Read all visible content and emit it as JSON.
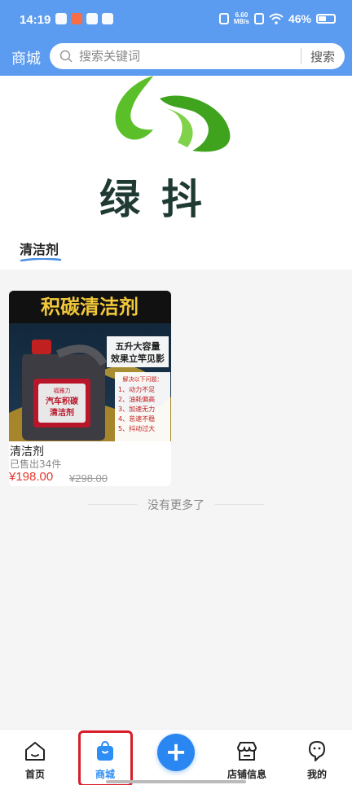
{
  "status_bar": {
    "time": "14:19",
    "net_speed": "6.60",
    "net_unit": "MB/s",
    "battery": "46%"
  },
  "header": {
    "title": "商城",
    "search_placeholder": "搜索关键词",
    "search_button": "搜索"
  },
  "store": {
    "logo_text": "绿抖",
    "category_tab": "清洁剂"
  },
  "products": [
    {
      "name": "清洁剂",
      "sold": "已售出34件",
      "price": "¥198.00",
      "original_price": "¥298.00",
      "image_text": {
        "headline": "积碳清洁剂",
        "promo_line1": "五升大容量",
        "promo_line2": "效果立竿见影",
        "bottle_brand": "福雅力",
        "bottle_label1": "汽车积碳",
        "bottle_label2": "清洁剂",
        "problems_title": "解决以下问题：",
        "problems": [
          "1、动力不足",
          "2、油耗偏高",
          "3、加速无力",
          "4、怠速不稳",
          "5、抖动过大"
        ]
      }
    }
  ],
  "list_end_text": "没有更多了",
  "bottom_nav": {
    "items": [
      {
        "label": "首页",
        "icon": "home-icon"
      },
      {
        "label": "商城",
        "icon": "shopping-bag-icon"
      },
      {
        "label": "",
        "icon": "plus-icon"
      },
      {
        "label": "店铺信息",
        "icon": "store-icon"
      },
      {
        "label": "我的",
        "icon": "user-icon"
      }
    ],
    "active_index": 1
  },
  "colors": {
    "header_bg": "#5b9bf0",
    "accent": "#2f8ef5",
    "price": "#e23a2e",
    "highlight": "#d81e2a",
    "logo_green": "#5bbf2a"
  }
}
